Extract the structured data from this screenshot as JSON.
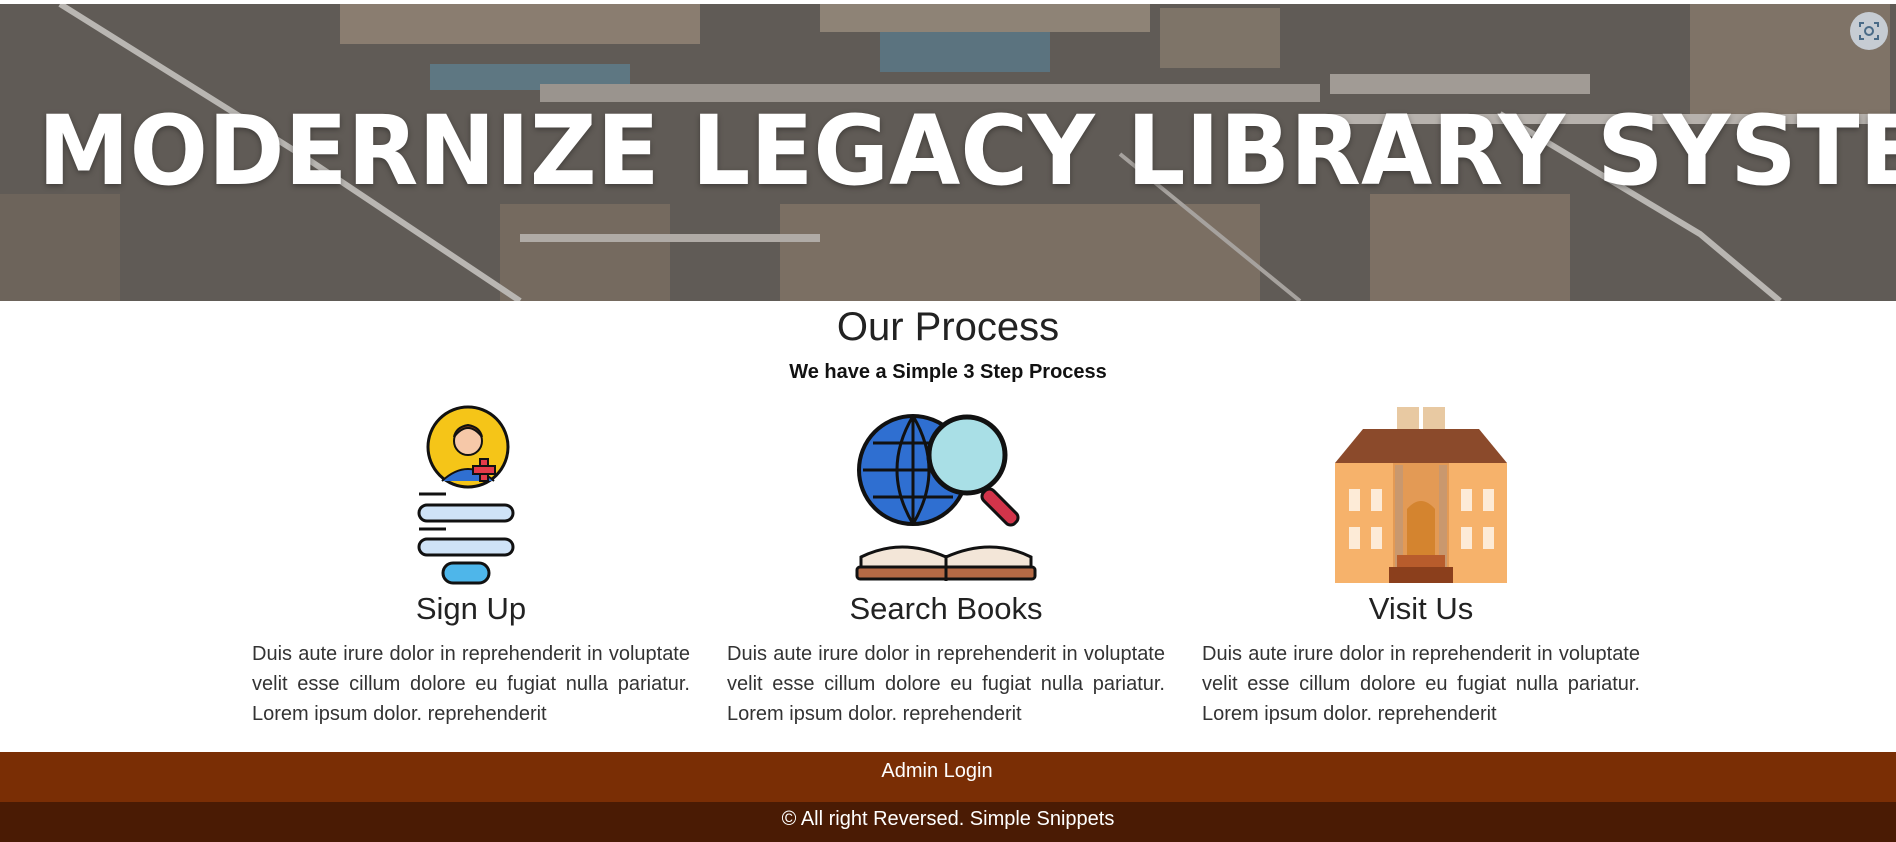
{
  "hero": {
    "title": "MODERNIZE LEGACY LIBRARY SYSTEMS",
    "capture_icon": "screenshot-capture-icon"
  },
  "process": {
    "title": "Our Process",
    "subtitle": "We have a Simple 3 Step Process",
    "steps": [
      {
        "icon": "user-signup-icon",
        "title": "Sign Up",
        "text": "Duis aute irure dolor in reprehenderit in voluptate velit esse cillum dolore eu fugiat nulla pariatur. Lorem ipsum dolor. reprehenderit"
      },
      {
        "icon": "globe-search-book-icon",
        "title": "Search Books",
        "text": "Duis aute irure dolor in reprehenderit in voluptate velit esse cillum dolore eu fugiat nulla pariatur. Lorem ipsum dolor. reprehenderit"
      },
      {
        "icon": "library-building-icon",
        "title": "Visit Us",
        "text": "Duis aute irure dolor in reprehenderit in voluptate velit esse cillum dolore eu fugiat nulla pariatur. Lorem ipsum dolor. reprehenderit"
      }
    ]
  },
  "footer": {
    "admin_label": "Admin Login",
    "copyright": "© All right Reversed. Simple Snippets"
  },
  "colors": {
    "footer_top": "#7a2e05",
    "footer_bottom": "#4a1b04"
  }
}
